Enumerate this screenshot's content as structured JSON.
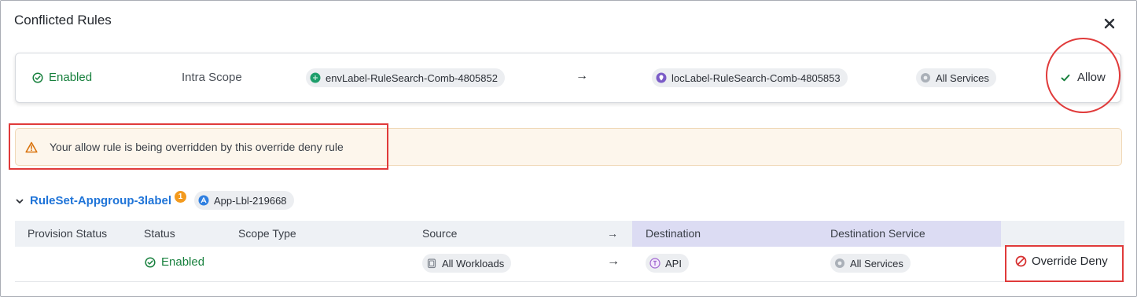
{
  "dialog": {
    "title": "Conflicted Rules"
  },
  "conflict_rule": {
    "status": "Enabled",
    "scope": "Intra Scope",
    "source_label": "envLabel-RuleSearch-Comb-4805852",
    "arrow": "→",
    "destination_label": "locLabel-RuleSearch-Comb-4805853",
    "service": "All Services",
    "action": "Allow"
  },
  "warning": {
    "text": "Your allow rule is being overridden by this override deny rule"
  },
  "ruleset": {
    "name": "RuleSet-Appgroup-3label",
    "badge_count": "1",
    "scope_label": "App-Lbl-219668"
  },
  "table": {
    "headers": {
      "provision_status": "Provision Status",
      "status": "Status",
      "scope_type": "Scope Type",
      "source": "Source",
      "arrow": "→",
      "destination": "Destination",
      "destination_service": "Destination Service"
    },
    "row": {
      "status": "Enabled",
      "source": "All Workloads",
      "arrow": "→",
      "destination": "API",
      "destination_service": "All Services",
      "action": "Override Deny"
    }
  },
  "colors": {
    "enabled_green": "#17803d",
    "link_blue": "#1f74d8",
    "warning_orange": "#d9730d",
    "deny_red": "#d63030",
    "highlight_red": "#e03a3a",
    "destination_header": "#dcdcf3"
  },
  "icons": {
    "close": "close-icon",
    "enabled": "check-circle-icon",
    "env_label": "env-label-icon",
    "loc_label": "location-label-icon",
    "services": "services-icon",
    "allow": "checkmark-icon",
    "warning": "warning-triangle-icon",
    "collapse": "chevron-down-icon",
    "app_label": "app-label-icon",
    "workloads": "workloads-icon",
    "api_label": "api-label-icon",
    "deny": "deny-circle-icon"
  }
}
